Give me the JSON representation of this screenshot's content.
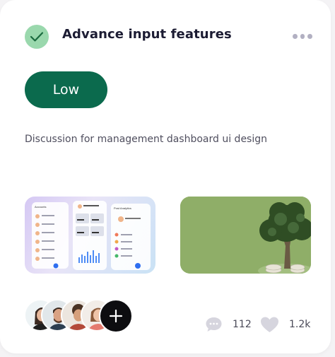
{
  "task": {
    "title": "Advance input features",
    "status_icon": "check-circle-icon",
    "priority": "Low",
    "description": "Discussion for management dashboard ui design"
  },
  "attachments": [
    {
      "label": "dashboard-preview",
      "panel_titles": [
        "Accounts",
        "Post Analytics"
      ]
    },
    {
      "label": "money-tree-photo"
    }
  ],
  "members": {
    "avatars": [
      "avatar-woman",
      "avatar-man-beard",
      "avatar-man-curly",
      "avatar-woman-smile"
    ],
    "add_icon": "plus-icon"
  },
  "stats": {
    "comments": "112",
    "likes": "1.2k"
  },
  "colors": {
    "accent": "#0b6a4d",
    "check_bg": "#9ad8ad",
    "title": "#1c1c33",
    "muted": "#b2b0c2"
  }
}
